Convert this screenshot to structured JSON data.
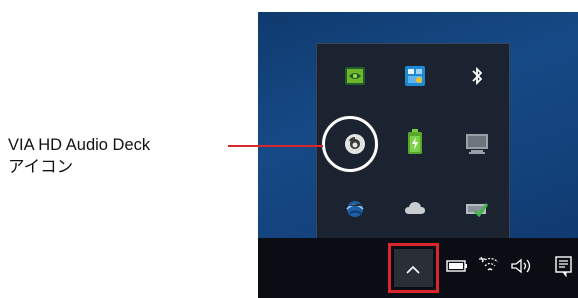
{
  "callout": {
    "line1": "VIA HD Audio Deck",
    "line2": "アイコン"
  },
  "tray_overflow_icons": [
    "nvidia-icon",
    "intel-graphics-icon",
    "bluetooth-icon",
    "via-hd-audio-deck-icon",
    "battery-charging-icon",
    "display-icon",
    "network-sphere-icon",
    "onedrive-icon",
    "safely-remove-hardware-icon"
  ],
  "taskbar": {
    "chevron": "show-hidden-icons-button",
    "system_icons": [
      "battery-icon",
      "wifi-icon",
      "volume-icon",
      "action-center-icon"
    ]
  },
  "colors": {
    "highlight_red": "#d9262c",
    "desktop_blue": "#164a86",
    "taskbar": "#0a0e14",
    "flyout": "#1b2330"
  }
}
